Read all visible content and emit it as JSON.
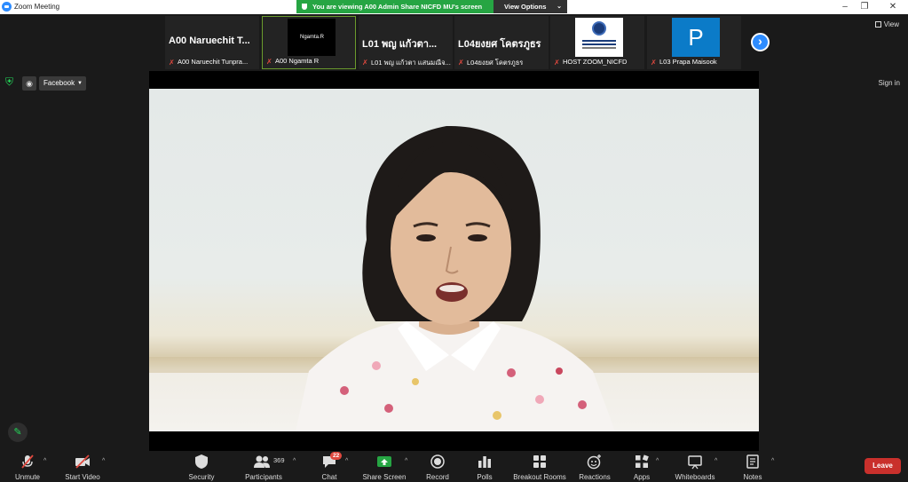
{
  "window": {
    "title": "Zoom Meeting"
  },
  "banner": {
    "viewing_text": "You are viewing A00 Admin Share NICFD MU's screen",
    "view_options_label": "View Options"
  },
  "thumbnails": [
    {
      "big_label": "A00 Naruechit T...",
      "name": "A00 Naruechit Tunpra..."
    },
    {
      "image_text": "Ngamta.R",
      "name": "A00 Ngamta R"
    },
    {
      "big_label": "L01 พญ แก้วตา...",
      "name": "L01 พญ แก้วตา แสนมณีจ..."
    },
    {
      "big_label": "L04ยงยศ โคตรภูธร",
      "name": "L04ยงยศ โคตรภูธร"
    },
    {
      "name": "HOST ZOOM_NICFD"
    },
    {
      "image_text": "P",
      "name": "L03 Prapa Maisook"
    }
  ],
  "view_label": "View",
  "subbar": {
    "facebook_label": "Facebook",
    "sign_in_label": "Sign in"
  },
  "toolbar": {
    "unmute": "Unmute",
    "start_video": "Start Video",
    "security": "Security",
    "participants": "Participants",
    "participants_count": "369",
    "chat": "Chat",
    "chat_badge": "22",
    "share_screen": "Share Screen",
    "record": "Record",
    "polls": "Polls",
    "breakout_rooms": "Breakout Rooms",
    "reactions": "Reactions",
    "apps": "Apps",
    "whiteboards": "Whiteboards",
    "notes": "Notes",
    "leave": "Leave"
  },
  "colors": {
    "share_green": "#26a543",
    "leave_red": "#c9302c",
    "accent_blue": "#2d8cff",
    "muted_red": "#e0483e"
  }
}
